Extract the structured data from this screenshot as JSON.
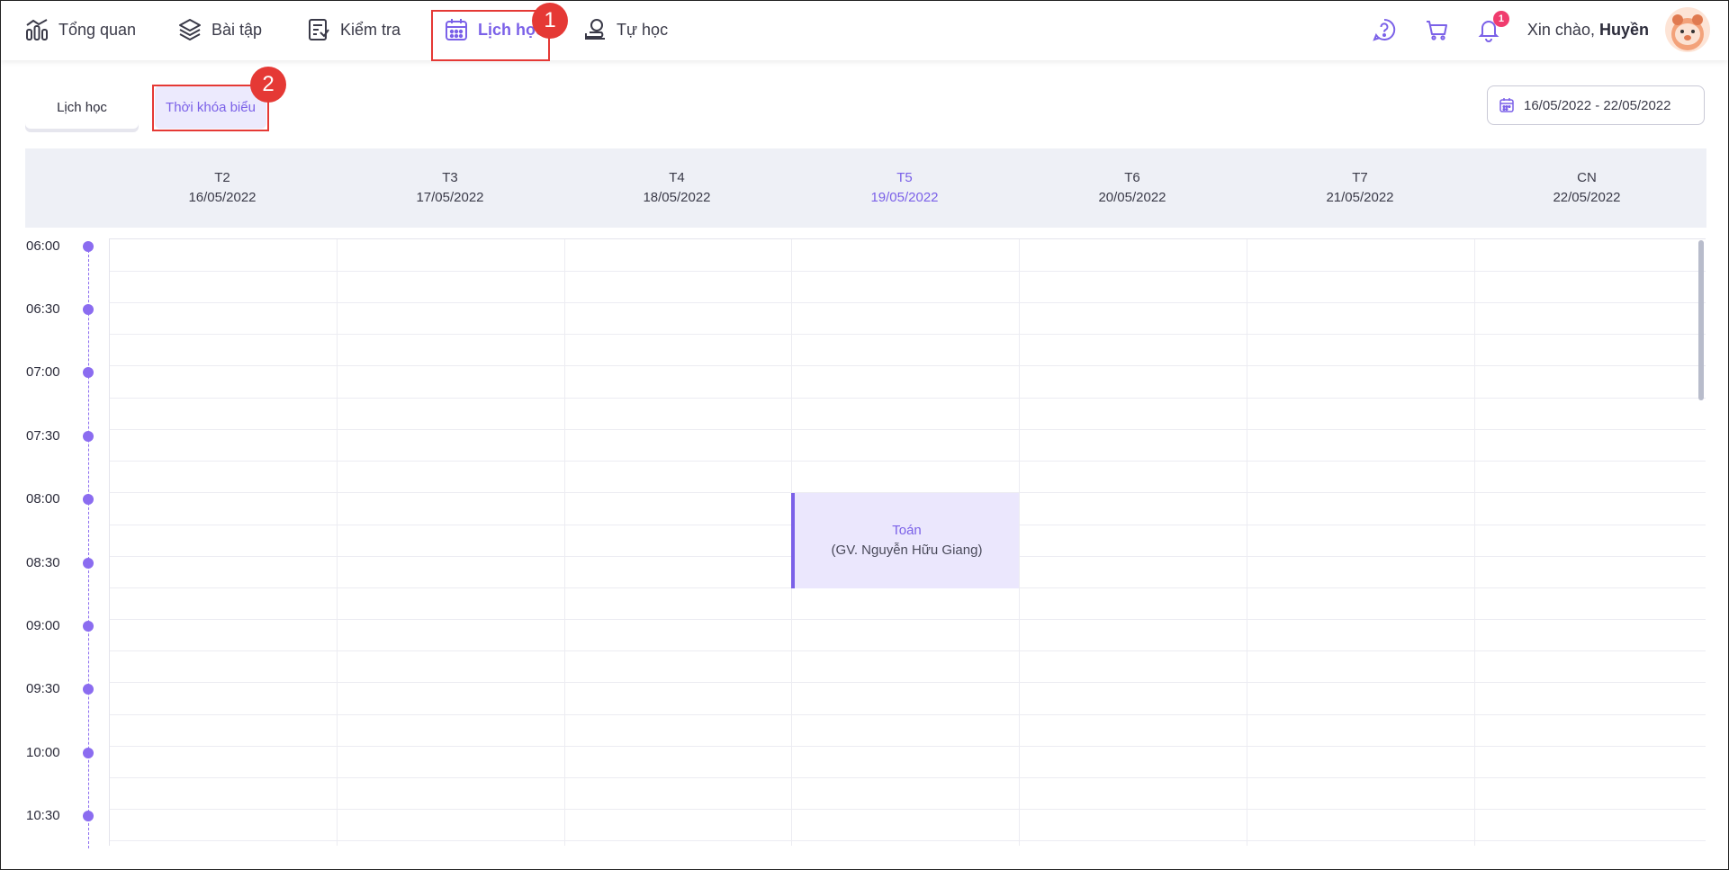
{
  "nav": {
    "items": [
      {
        "label": "Tổng quan",
        "icon": "chart-icon"
      },
      {
        "label": "Bài tập",
        "icon": "layers-icon"
      },
      {
        "label": "Kiểm tra",
        "icon": "test-icon"
      },
      {
        "label": "Lịch học",
        "icon": "calendar-icon",
        "active": true
      },
      {
        "label": "Tự học",
        "icon": "self-study-icon"
      }
    ],
    "greeting": "Xin chào,",
    "user_name": "Huyền",
    "notification_count": "1"
  },
  "annotations": {
    "one": "1",
    "two": "2"
  },
  "subtabs": {
    "schedule": "Lịch học",
    "timetable": "Thời khóa biểu"
  },
  "date_range": "16/05/2022 - 22/05/2022",
  "days": [
    {
      "name": "T2",
      "date": "16/05/2022"
    },
    {
      "name": "T3",
      "date": "17/05/2022"
    },
    {
      "name": "T4",
      "date": "18/05/2022"
    },
    {
      "name": "T5",
      "date": "19/05/2022",
      "today": true
    },
    {
      "name": "T6",
      "date": "20/05/2022"
    },
    {
      "name": "T7",
      "date": "21/05/2022"
    },
    {
      "name": "CN",
      "date": "22/05/2022"
    }
  ],
  "times": [
    "06:00",
    "06:30",
    "07:00",
    "07:30",
    "08:00",
    "08:30",
    "09:00",
    "09:30",
    "10:00",
    "10:30"
  ],
  "event": {
    "subject": "Toán",
    "teacher": "(GV. Nguyễn Hữu Giang)",
    "day": "T5",
    "start": "08:00",
    "end": "08:45"
  },
  "colors": {
    "accent": "#7b61e8",
    "annotation": "#e53935",
    "badge": "#f03c6e"
  }
}
